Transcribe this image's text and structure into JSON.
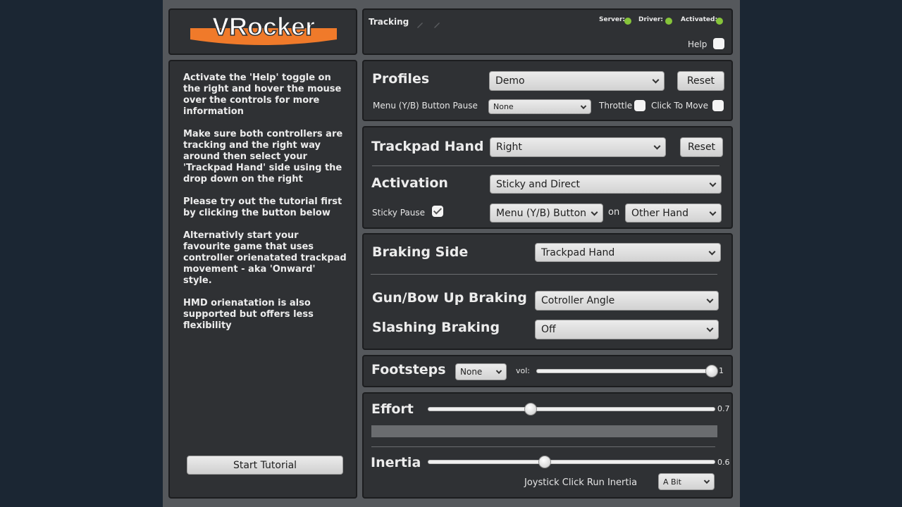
{
  "logo": {
    "text": "VRocker"
  },
  "status_bar": {
    "tracking_label": "Tracking",
    "server_label": "Server:",
    "driver_label": "Driver:",
    "activated_label": "Activated:",
    "help_label": "Help",
    "indicator_color": "#86c43a"
  },
  "help_panel": {
    "paragraphs": [
      "Activate the 'Help' toggle on the right and hover the mouse over the controls for more information",
      "Make sure both controllers are tracking and the right way around then select your 'Trackpad Hand' side using the drop down on the right",
      "Please try out the tutorial first by clicking the button below",
      "Alternativly start your favourite game that uses controller orienatated trackpad movement - aka 'Onward' style.",
      "HMD orienatation is also supported but offers less flexibility"
    ],
    "start_tutorial_label": "Start Tutorial"
  },
  "profiles": {
    "title": "Profiles",
    "selected": "Demo",
    "reset_label": "Reset",
    "menu_pause_label": "Menu (Y/B) Button Pause",
    "menu_pause_selected": "None",
    "throttle_label": "Throttle",
    "click_to_move_label": "Click To Move"
  },
  "trackpad": {
    "hand_title": "Trackpad Hand",
    "hand_selected": "Right",
    "reset_label": "Reset",
    "activation_title": "Activation",
    "activation_selected": "Sticky and Direct",
    "sticky_pause_label": "Sticky Pause",
    "sticky_pause_button_selected": "Menu (Y/B) Button",
    "on_label": "on",
    "sticky_pause_hand_selected": "Other Hand"
  },
  "braking": {
    "side_title": "Braking Side",
    "side_selected": "Trackpad Hand",
    "gun_title": "Gun/Bow Up Braking",
    "gun_selected": "Cotroller Angle",
    "slashing_title": "Slashing Braking",
    "slashing_selected": "Off"
  },
  "footsteps": {
    "title": "Footsteps",
    "selected": "None",
    "vol_label": "vol:",
    "vol_value": "1",
    "vol_level": 1.0
  },
  "effort": {
    "title": "Effort",
    "value": "0.7",
    "level": 0.35,
    "inertia_title": "Inertia",
    "inertia_value": "0.6",
    "inertia_level": 0.4,
    "joystick_label": "Joystick Click Run Inertia",
    "joystick_selected": "A Bit"
  }
}
